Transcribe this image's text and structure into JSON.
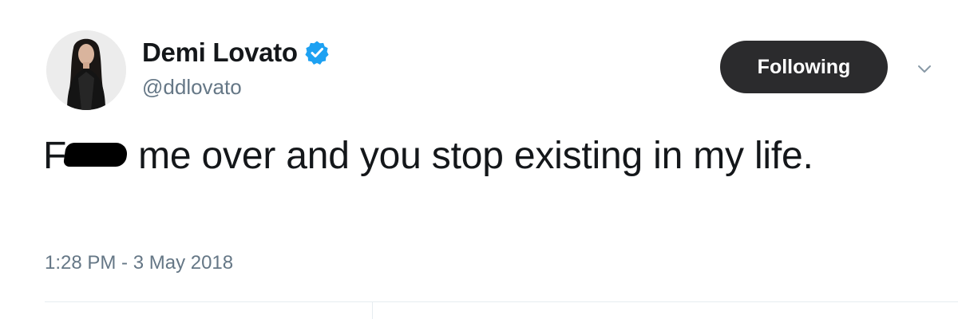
{
  "user": {
    "display_name": "Demi Lovato",
    "handle": "@ddlovato",
    "verified": true,
    "avatar_icon": "profile-photo-avatar"
  },
  "follow_button": {
    "label": "Following"
  },
  "menu": {
    "icon": "chevron-down-icon"
  },
  "tweet": {
    "text_before_redaction": "F",
    "text_after_redaction": "me over and you stop existing in my life.",
    "timestamp": "1:28 PM - 3 May 2018"
  },
  "colors": {
    "text": "#14171a",
    "secondary_text": "#657786",
    "verified_blue": "#1da1f2",
    "button_bg": "#2b2b2d",
    "divider": "#e6ecf0"
  }
}
